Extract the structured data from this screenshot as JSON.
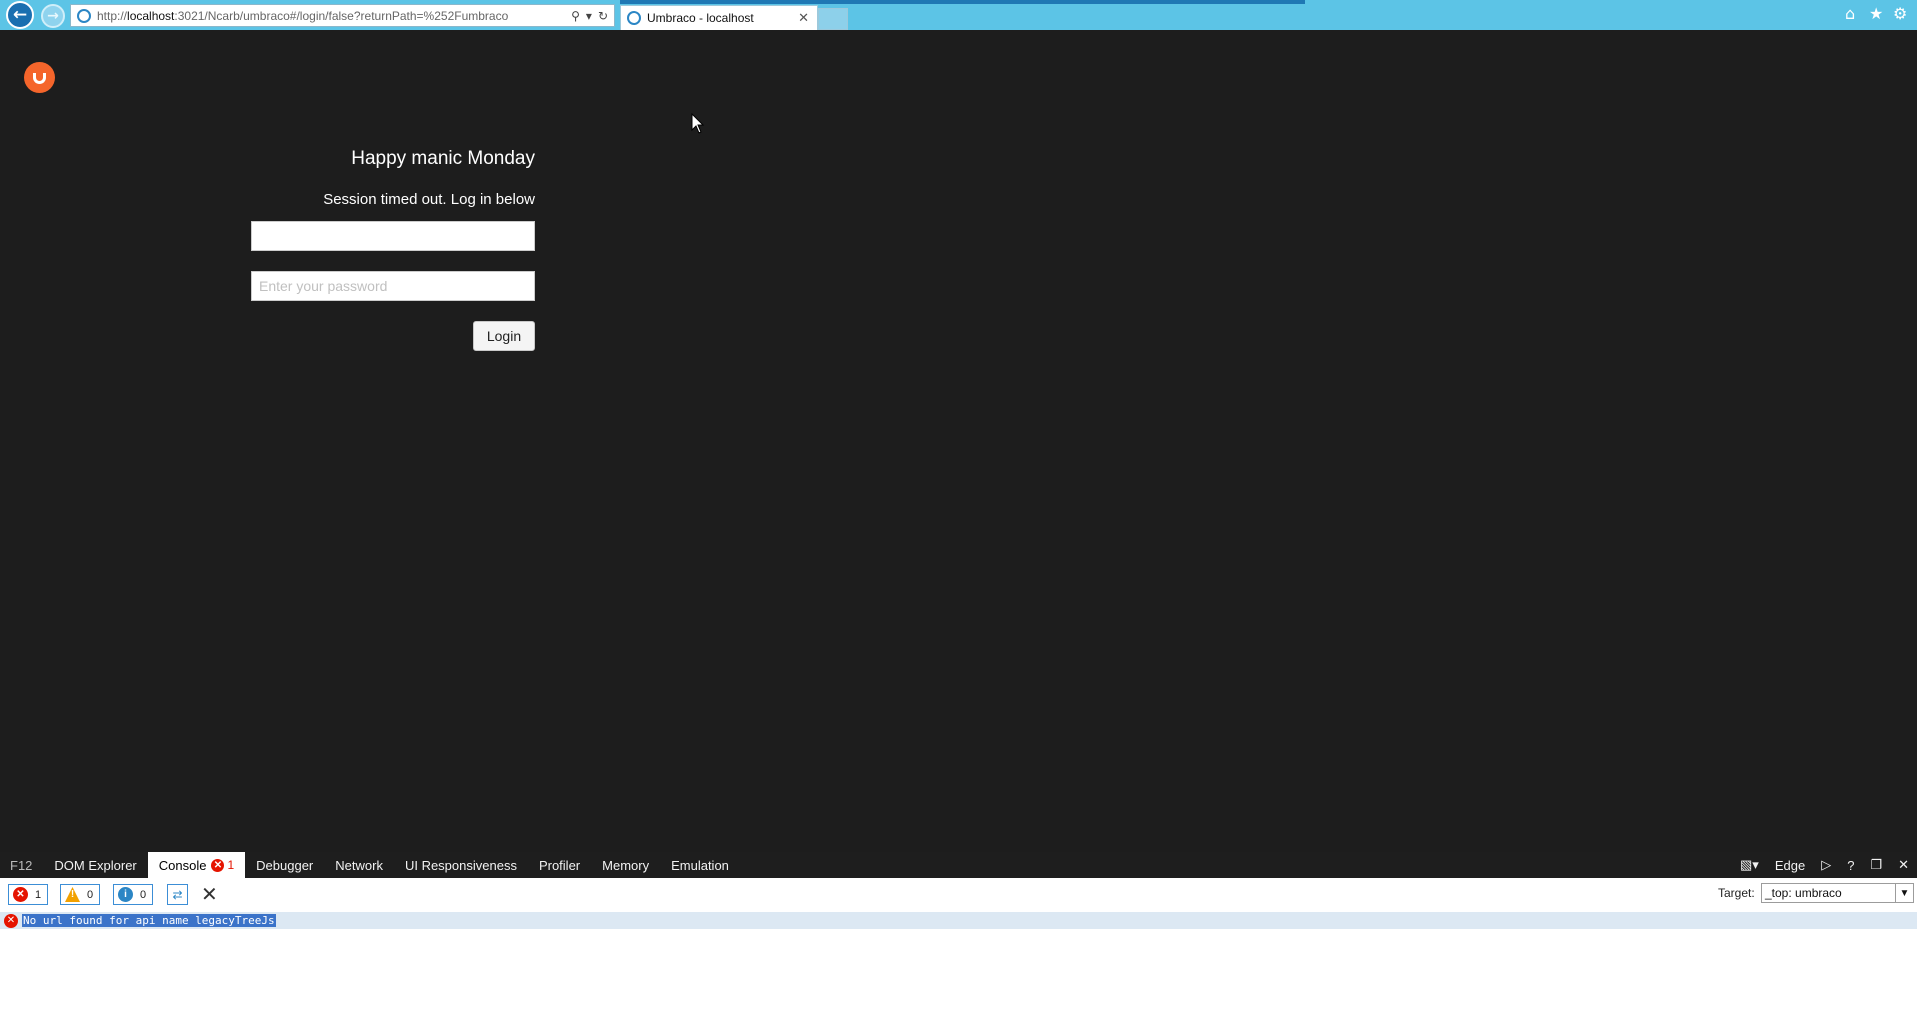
{
  "browser": {
    "url_prefix": "http://",
    "url_host": "localhost",
    "url_rest": ":3021/Ncarb/umbraco#/login/false?returnPath=%252Fumbraco",
    "tab_title": "Umbraco - localhost",
    "back_icon": "back-arrow-icon",
    "forward_icon": "forward-arrow-icon",
    "accent": "#5cc4e6"
  },
  "page": {
    "background": "#1d1d1d",
    "logo_color": "#f5652b",
    "greeting": "Happy manic Monday",
    "session_message": "Session timed out. Log in below",
    "username_value": "",
    "password_placeholder": "Enter your password",
    "login_label": "Login"
  },
  "devtools": {
    "tabs": [
      {
        "label": "F12"
      },
      {
        "label": "DOM Explorer"
      },
      {
        "label": "Console",
        "error_count": "1",
        "active": true
      },
      {
        "label": "Debugger"
      },
      {
        "label": "Network"
      },
      {
        "label": "UI Responsiveness"
      },
      {
        "label": "Profiler"
      },
      {
        "label": "Memory"
      },
      {
        "label": "Emulation"
      }
    ],
    "document_mode": "Edge",
    "filters": {
      "errors": "1",
      "warnings": "0",
      "info": "0"
    },
    "target_label": "Target:",
    "target_value": "_top: umbraco",
    "console_messages": [
      {
        "level": "error",
        "text": "No url found for api name legacyTreeJs"
      }
    ]
  }
}
